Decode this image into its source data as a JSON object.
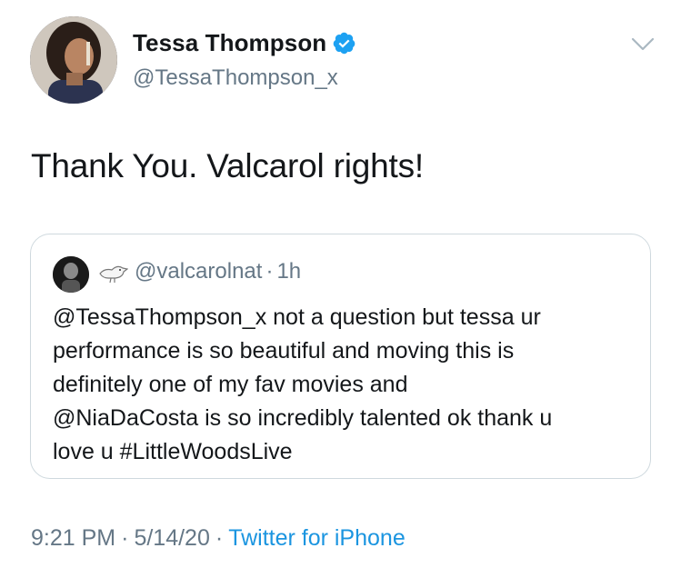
{
  "author": {
    "display_name": "Tessa Thompson",
    "handle": "@TessaThompson_x",
    "verified": true
  },
  "tweet": {
    "text": "Thank You. Valcarol rights!"
  },
  "quoted_tweet": {
    "handle": "@valcarolnat",
    "separator": "·",
    "time_ago": "1h",
    "emoji": "bird-emoji",
    "lines": [
      "@TessaThompson_x not a question but tessa ur",
      "performance is so beautiful and moving this is",
      "definitely one of my fav movies and",
      "@NiaDaCosta is so incredibly talented ok thank u",
      "love u #LittleWoodsLive"
    ]
  },
  "meta": {
    "time": "9:21 PM",
    "separator": "·",
    "date": "5/14/20",
    "source": "Twitter for iPhone"
  },
  "colors": {
    "primary_text": "#14171a",
    "secondary_text": "#657786",
    "link": "#1b95e0",
    "verified_badge": "#1da1f2",
    "border": "#cfd9de"
  },
  "icons": [
    "verified-badge-icon",
    "chevron-down-icon"
  ]
}
